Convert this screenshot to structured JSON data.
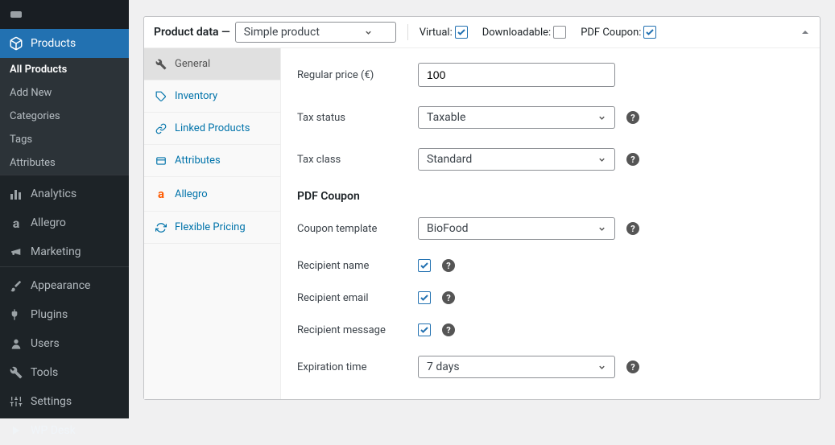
{
  "admin_sidebar": {
    "products": "Products",
    "submenu": {
      "all_products": "All Products",
      "add_new": "Add New",
      "categories": "Categories",
      "tags": "Tags",
      "attributes": "Attributes"
    },
    "analytics": "Analytics",
    "allegro": "Allegro",
    "marketing": "Marketing",
    "appearance": "Appearance",
    "plugins": "Plugins",
    "users": "Users",
    "tools": "Tools",
    "settings": "Settings",
    "wpdesk": "WP Desk"
  },
  "panel": {
    "title": "Product data —",
    "type_select": "Simple product",
    "virtual_label": "Virtual:",
    "virtual_checked": true,
    "downloadable_label": "Downloadable:",
    "downloadable_checked": false,
    "pdf_coupon_label": "PDF Coupon:",
    "pdf_coupon_checked": true
  },
  "tabs": {
    "general": "General",
    "inventory": "Inventory",
    "linked": "Linked Products",
    "attributes": "Attributes",
    "allegro": "Allegro",
    "pricing": "Flexible Pricing"
  },
  "form": {
    "regular_price_label": "Regular price (€)",
    "regular_price_value": "100",
    "tax_status_label": "Tax status",
    "tax_status_value": "Taxable",
    "tax_class_label": "Tax class",
    "tax_class_value": "Standard",
    "section": "PDF Coupon",
    "coupon_template_label": "Coupon template",
    "coupon_template_value": "BioFood",
    "recipient_name_label": "Recipient name",
    "recipient_email_label": "Recipient email",
    "recipient_message_label": "Recipient message",
    "expiration_label": "Expiration time",
    "expiration_value": "7 days"
  }
}
